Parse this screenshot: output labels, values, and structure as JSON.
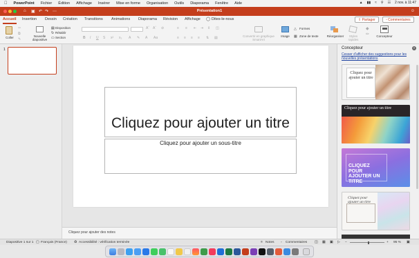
{
  "menubar": {
    "app": "PowerPoint",
    "items": [
      "Fichier",
      "Édition",
      "Affichage",
      "Insérer",
      "Mise en forme",
      "Organisation",
      "Outils",
      "Diaporama",
      "Fenêtre",
      "Aide"
    ],
    "clock": "2 nov. à 11:47"
  },
  "window": {
    "title": "Présentation1"
  },
  "tabs": [
    "Accueil",
    "Insertion",
    "Dessin",
    "Création",
    "Transitions",
    "Animations",
    "Diaporama",
    "Révision",
    "Affichage"
  ],
  "tell_me": "Dites-le-nous",
  "share": {
    "partager": "Partager",
    "commentaires": "Commentaires"
  },
  "ribbon": {
    "coller": "Coller",
    "nouvelle_diapo": "Nouvelle diapositive",
    "disposition": "Disposition",
    "retablir": "Rétablir",
    "section": "Section",
    "smartart": "Convertir en graphique SmartArt",
    "image": "Image",
    "formes": "Formes",
    "zone_texte": "Zone de texte",
    "reorganiser": "Réorganiser",
    "styles_rapides": "Styles rapides",
    "concepteur": "Concepteur"
  },
  "slides_panel": {
    "slide_number": "1"
  },
  "slide": {
    "title_placeholder": "Cliquez pour ajouter un titre",
    "subtitle_placeholder": "Cliquez pour ajouter un sous-titre"
  },
  "notes_placeholder": "Cliquez pour ajouter des notes",
  "designer": {
    "title": "Concepteur",
    "link": "Cesser d'afficher des suggestions pour les nouvelles présentations",
    "cards": [
      {
        "text": "Cliquez pour ajouter un titre"
      },
      {
        "text": "Cliquez pour ajouter un titre"
      },
      {
        "text": "CLIQUEZ POUR AJOUTER UN TITRE"
      },
      {
        "text": "Cliquez pour ajouter un titre"
      }
    ]
  },
  "status": {
    "slide_info": "Diapositive 1 sur 1",
    "language": "Français (France)",
    "accessibility": "Accessibilité : vérification terminée",
    "notes": "Notes",
    "comments": "Commentaires",
    "zoom": "95 %"
  },
  "colors": {
    "accent": "#c43e1c",
    "link": "#1a3f9f"
  }
}
